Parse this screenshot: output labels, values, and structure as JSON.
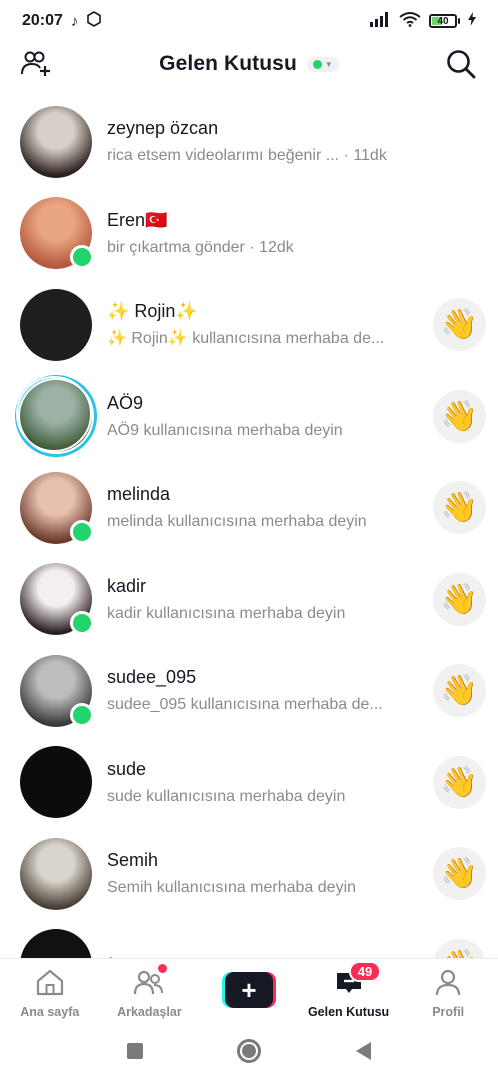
{
  "status_bar": {
    "time": "20:07",
    "battery": "40"
  },
  "header": {
    "title": "Gelen Kutusu"
  },
  "conversations": [
    {
      "name": "zeynep özcan",
      "subtitle": "rica etsem videolarımı beğenir ... · 11dk",
      "online": false,
      "story": false,
      "wave": false,
      "avatar": [
        "#d8cfc9",
        "#2a1f1c"
      ]
    },
    {
      "name": "Eren🇹🇷",
      "subtitle": "bir çıkartma gönder · 12dk",
      "online": true,
      "story": false,
      "wave": false,
      "avatar": [
        "#e9a680",
        "#b2573d"
      ]
    },
    {
      "name": "✨ Rojin✨",
      "subtitle": "✨ Rojin✨  kullanıcısına merhaba de...",
      "online": false,
      "story": false,
      "wave": true,
      "avatar": [
        "#1e1e1e",
        "#1e1e1e"
      ]
    },
    {
      "name": "AÖ9",
      "subtitle": "AÖ9 kullanıcısına merhaba deyin",
      "online": false,
      "story": true,
      "wave": true,
      "avatar": [
        "#9bb2a5",
        "#3e5a38"
      ]
    },
    {
      "name": "melinda",
      "subtitle": "melinda kullanıcısına merhaba deyin",
      "online": true,
      "story": false,
      "wave": true,
      "avatar": [
        "#e7c0b0",
        "#6b3a2b"
      ]
    },
    {
      "name": "kadir",
      "subtitle": "kadir kullanıcısına merhaba deyin",
      "online": true,
      "story": false,
      "wave": true,
      "avatar": [
        "#f4eeee",
        "#2a2024"
      ]
    },
    {
      "name": "sudee_095",
      "subtitle": "sudee_095 kullanıcısına merhaba de...",
      "online": true,
      "story": false,
      "wave": true,
      "avatar": [
        "#bdbdbd",
        "#3a3a3a"
      ]
    },
    {
      "name": "sude",
      "subtitle": "sude kullanıcısına merhaba deyin",
      "online": false,
      "story": false,
      "wave": true,
      "avatar": [
        "#0c0c0c",
        "#0c0c0c"
      ]
    },
    {
      "name": "Semih",
      "subtitle": "Semih kullanıcısına merhaba deyin",
      "online": false,
      "story": false,
      "wave": true,
      "avatar": [
        "#d9d4cc",
        "#4a3f36"
      ]
    },
    {
      "name": "feyzoss",
      "subtitle": "",
      "online": false,
      "story": false,
      "wave": true,
      "avatar": [
        "#111111",
        "#111111"
      ]
    }
  ],
  "wave_emoji": "👋",
  "tabs": [
    {
      "label": "Ana sayfa",
      "icon": "home-icon",
      "active": false
    },
    {
      "label": "Arkadaşlar",
      "icon": "friends-icon",
      "active": false,
      "dot": true
    },
    {
      "label": "",
      "icon": "plus-icon",
      "active": false
    },
    {
      "label": "Gelen Kutusu",
      "icon": "inbox-icon",
      "active": true,
      "badge": "49"
    },
    {
      "label": "Profil",
      "icon": "profile-icon",
      "active": false
    }
  ],
  "colors": {
    "online": "#20d56b",
    "accent": "#fe2c55",
    "cyan": "#25f4ee",
    "story_ring": "#2ac4e6"
  }
}
